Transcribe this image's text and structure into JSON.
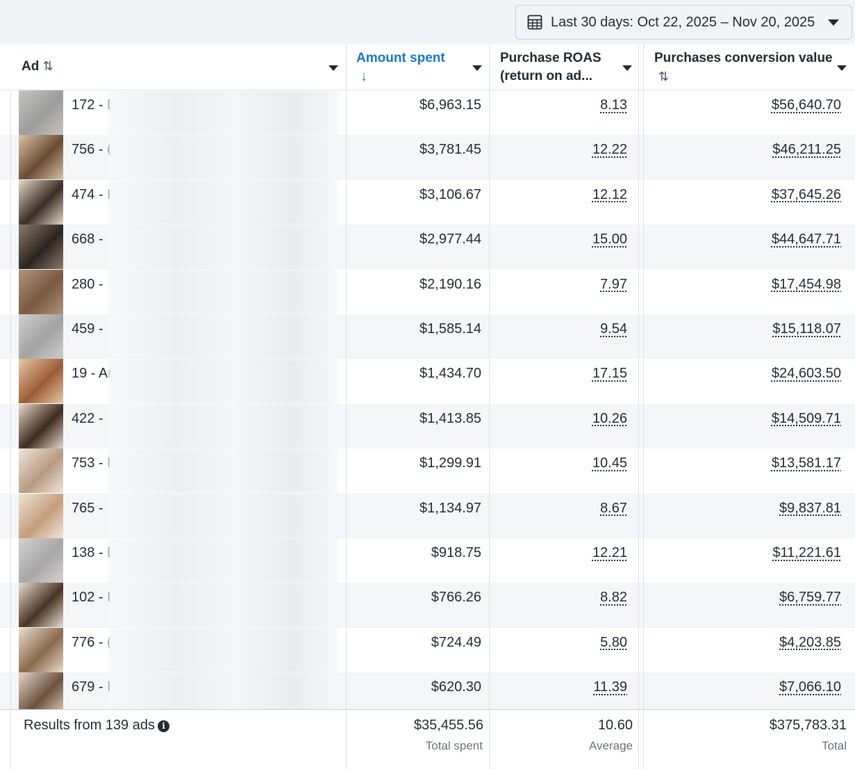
{
  "date_range": {
    "label": "Last 30 days: Oct 22, 2025 – Nov 20, 2025"
  },
  "columns": {
    "ad": "Ad",
    "amount_spent": "Amount spent",
    "roas_line1": "Purchase ROAS",
    "roas_line2": "(return on ad...",
    "conv_value": "Purchases conversion value"
  },
  "colors": {
    "accent": "#1877c9",
    "text": "#1c2b33",
    "alt_row": "#f4f6f8"
  },
  "rows": [
    {
      "ad": "172 - D",
      "spent": "$6,963.15",
      "roas": "8.13",
      "value": "$56,640.70",
      "thumb": [
        "#9c9c9a",
        "#c6c5c3"
      ]
    },
    {
      "ad": "756 - (",
      "spent": "$3,781.45",
      "roas": "12.22",
      "value": "$46,211.25",
      "thumb": [
        "#6b4a33",
        "#d8c3a6"
      ]
    },
    {
      "ad": "474 - I",
      "spent": "$3,106.67",
      "roas": "12.12",
      "value": "$37,645.26",
      "thumb": [
        "#3a2d24",
        "#e2d7c8"
      ]
    },
    {
      "ad": "668 -",
      "spent": "$2,977.44",
      "roas": "15.00",
      "value": "$44,647.71",
      "thumb": [
        "#2a2420",
        "#8b7a68"
      ]
    },
    {
      "ad": "280 -",
      "spent": "$2,190.16",
      "roas": "7.97",
      "value": "$17,454.98",
      "thumb": [
        "#7a5a42",
        "#b09279"
      ]
    },
    {
      "ad": "459 -",
      "spent": "$1,585.14",
      "roas": "9.54",
      "value": "$15,118.07",
      "thumb": [
        "#a3a3a3",
        "#cfcfcf"
      ]
    },
    {
      "ad": "19 - Ar",
      "spent": "$1,434.70",
      "roas": "17.15",
      "value": "$24,603.50",
      "thumb": [
        "#9b5c36",
        "#e8c9a6"
      ]
    },
    {
      "ad": "422 -",
      "spent": "$1,413.85",
      "roas": "10.26",
      "value": "$14,509.71",
      "thumb": [
        "#3d2b1f",
        "#e7d8c8"
      ]
    },
    {
      "ad": "753 - I",
      "spent": "$1,299.91",
      "roas": "10.45",
      "value": "$13,581.17",
      "thumb": [
        "#b79b82",
        "#efe6dc"
      ]
    },
    {
      "ad": "765 -",
      "spent": "$1,134.97",
      "roas": "8.67",
      "value": "$9,837.81",
      "thumb": [
        "#c49e7c",
        "#f0e4d6"
      ]
    },
    {
      "ad": "138 - D",
      "spent": "$918.75",
      "roas": "12.21",
      "value": "$11,221.61",
      "thumb": [
        "#a8a7a5",
        "#d3d2cf"
      ]
    },
    {
      "ad": "102 - I",
      "spent": "$766.26",
      "roas": "8.82",
      "value": "$6,759.77",
      "thumb": [
        "#4a3325",
        "#e6dccf"
      ]
    },
    {
      "ad": "776 - (",
      "spent": "$724.49",
      "roas": "5.80",
      "value": "$4,203.85",
      "thumb": [
        "#8a6a4c",
        "#e9dccb"
      ]
    },
    {
      "ad": "679 - I",
      "spent": "$620.30",
      "roas": "11.39",
      "value": "$7,066.10",
      "thumb": [
        "#6d5040",
        "#e3d6c7"
      ]
    }
  ],
  "footer": {
    "results": "Results from 139 ads",
    "total_spent": "$35,455.56",
    "total_spent_label": "Total spent",
    "avg_roas": "10.60",
    "avg_roas_label": "Average",
    "total_value": "$375,783.31",
    "total_value_label": "Total"
  }
}
